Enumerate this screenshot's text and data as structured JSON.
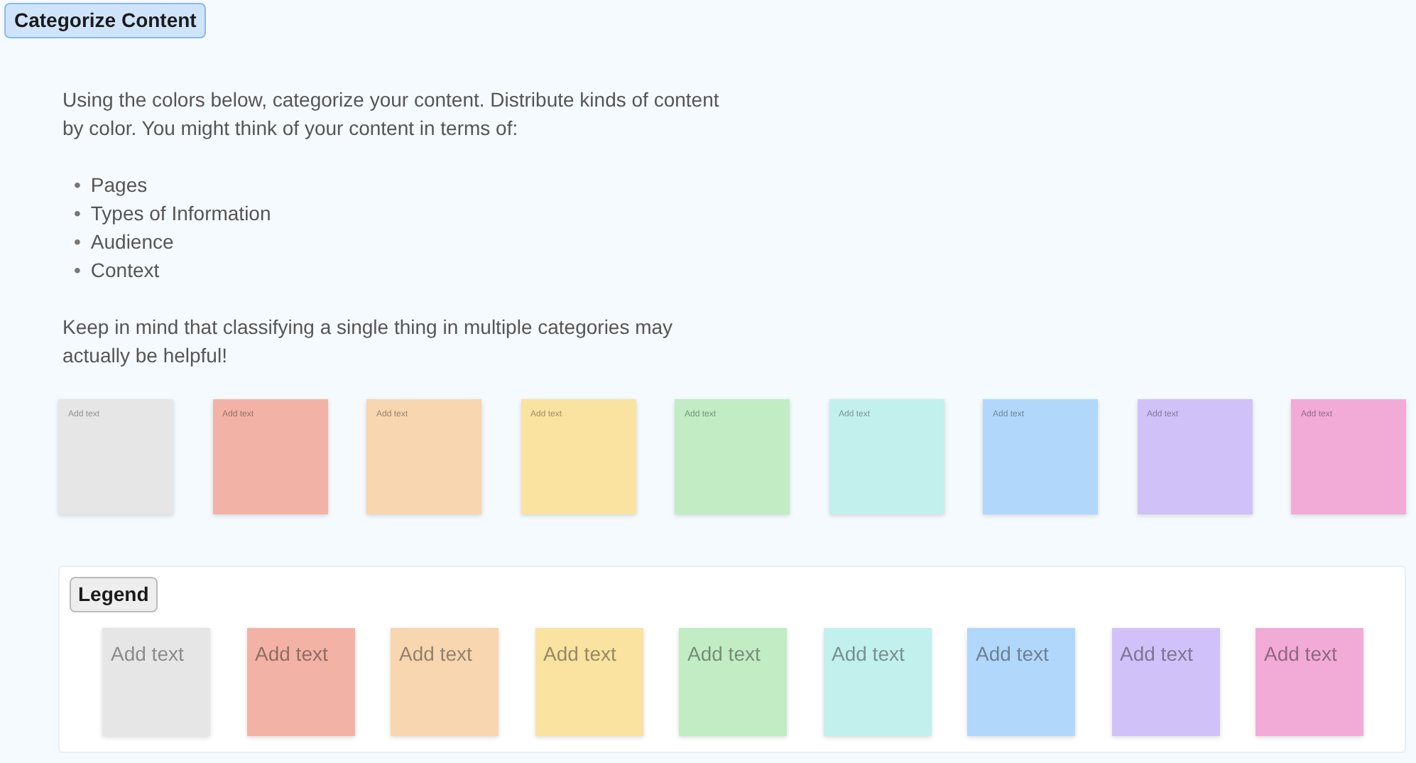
{
  "title": "Categorize Content",
  "intro": "Using the colors below, categorize your content. Distribute kinds of content by color. You might think of your content in terms of:",
  "list": [
    {
      "bullet": "•",
      "text": "Pages"
    },
    {
      "bullet": "•",
      "text": "Types of Information"
    },
    {
      "bullet": "•",
      "text": "Audience"
    },
    {
      "bullet": "•",
      "text": "Context"
    }
  ],
  "note": "Keep in mind that classifying a single thing in multiple categories may actually be helpful!",
  "stickies": [
    {
      "text": "Add text",
      "color": "#e6e6e6"
    },
    {
      "text": "Add text",
      "color": "#f2b3a6"
    },
    {
      "text": "Add text",
      "color": "#f7d6b0"
    },
    {
      "text": "Add text",
      "color": "#fae3a0"
    },
    {
      "text": "Add text",
      "color": "#c1ecc4"
    },
    {
      "text": "Add text",
      "color": "#c2f0ed"
    },
    {
      "text": "Add text",
      "color": "#b1d7fb"
    },
    {
      "text": "Add text",
      "color": "#d0c2f8"
    },
    {
      "text": "Add text",
      "color": "#f1abd6"
    }
  ],
  "legend": {
    "label": "Legend",
    "stickies": [
      {
        "text": "Add text",
        "color": "#e6e6e6"
      },
      {
        "text": "Add text",
        "color": "#f2b3a6"
      },
      {
        "text": "Add text",
        "color": "#f7d6b0"
      },
      {
        "text": "Add text",
        "color": "#fae3a0"
      },
      {
        "text": "Add text",
        "color": "#c1ecc4"
      },
      {
        "text": "Add text",
        "color": "#c2f0ed"
      },
      {
        "text": "Add text",
        "color": "#b1d7fb"
      },
      {
        "text": "Add text",
        "color": "#d0c2f8"
      },
      {
        "text": "Add text",
        "color": "#f1abd6"
      }
    ]
  }
}
